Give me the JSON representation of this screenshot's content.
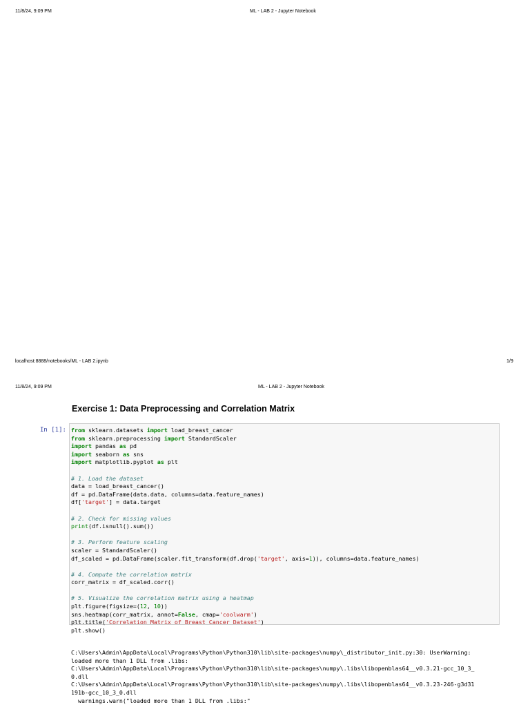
{
  "page1": {
    "header_left": "11/8/24, 9:09 PM",
    "header_center": "ML - LAB 2 - Jupyter Notebook",
    "footer_left": "localhost:8888/notebooks/ML - LAB 2.ipynb",
    "footer_right": "1/9"
  },
  "page2": {
    "header_left": "11/8/24, 9:09 PM",
    "header_center": "ML - LAB 2 - Jupyter Notebook"
  },
  "notebook": {
    "section_title": "Exercise 1: Data Preprocessing and Correlation Matrix",
    "cell_prompt": "In [1]:",
    "code": {
      "l1_from": "from",
      "l1_mod": " sklearn.datasets ",
      "l1_import": "import",
      "l1_name": " load_breast_cancer",
      "l2_from": "from",
      "l2_mod": " sklearn.preprocessing ",
      "l2_import": "import",
      "l2_name": " StandardScaler",
      "l3_import": "import",
      "l3_mod": " pandas ",
      "l3_as": "as",
      "l3_alias": " pd",
      "l4_import": "import",
      "l4_mod": " seaborn ",
      "l4_as": "as",
      "l4_alias": " sns",
      "l5_import": "import",
      "l5_mod": " matplotlib.pyplot ",
      "l5_as": "as",
      "l5_alias": " plt",
      "c1": "# 1. Load the dataset",
      "l7": "data = load_breast_cancer()",
      "l8": "df = pd.DataFrame(data.data, columns=data.feature_names)",
      "l9a": "df[",
      "l9s": "'target'",
      "l9b": "] = data.target",
      "c2": "# 2. Check for missing values",
      "l11a": "print",
      "l11b": "(df.isnull().sum())",
      "c3": "# 3. Perform feature scaling",
      "l13": "scaler = StandardScaler()",
      "l14a": "df_scaled = pd.DataFrame(scaler.fit_transform(df.drop(",
      "l14s": "'target'",
      "l14b": ", axis=",
      "l14n": "1",
      "l14c": ")), columns=data.feature_names)",
      "c4": "# 4. Compute the correlation matrix",
      "l16": "corr_matrix = df_scaled.corr()",
      "c5": "# 5. Visualize the correlation matrix using a heatmap",
      "l18a": "plt.figure(figsize=(",
      "l18n1": "12",
      "l18b": ", ",
      "l18n2": "10",
      "l18c": "))",
      "l19a": "sns.heatmap(corr_matrix, annot=",
      "l19k": "False",
      "l19b": ", cmap=",
      "l19s": "'coolwarm'",
      "l19c": ")",
      "l20a": "plt.title(",
      "l20s": "'Correlation Matrix of Breast Cancer Dataset'",
      "l20b": ")",
      "l21": "plt.show()"
    },
    "output_lines": [
      "C:\\Users\\Admin\\AppData\\Local\\Programs\\Python\\Python310\\lib\\site-packages\\numpy\\_distributor_init.py:30: UserWarning:",
      "loaded more than 1 DLL from .libs:",
      "C:\\Users\\Admin\\AppData\\Local\\Programs\\Python\\Python310\\lib\\site-packages\\numpy\\.libs\\libopenblas64__v0.3.21-gcc_10_3_",
      "0.dll",
      "C:\\Users\\Admin\\AppData\\Local\\Programs\\Python\\Python310\\lib\\site-packages\\numpy\\.libs\\libopenblas64__v0.3.23-246-g3d31",
      "191b-gcc_10_3_0.dll",
      "  warnings.warn(\"loaded more than 1 DLL from .libs:\""
    ]
  }
}
